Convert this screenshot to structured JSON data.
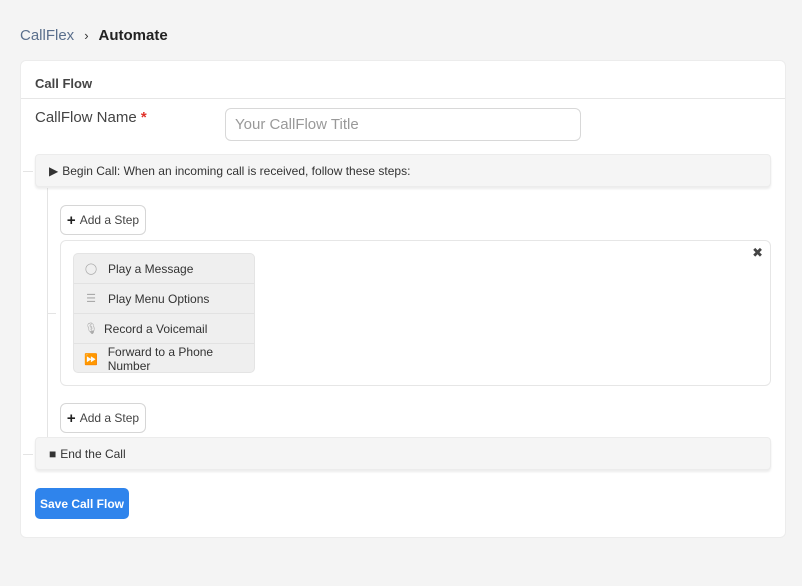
{
  "breadcrumb": {
    "home": "CallFlex",
    "separator": "›",
    "current": "Automate"
  },
  "card": {
    "title": "Call Flow"
  },
  "form": {
    "name_label": "CallFlow Name",
    "required_mark": "*",
    "name_placeholder": "Your CallFlow Title",
    "name_value": ""
  },
  "flow": {
    "begin": {
      "icon": "play-triangle-icon",
      "glyph": "▶",
      "label": "Begin Call: When an incoming call is received, follow these steps:"
    },
    "add_step": {
      "glyph": "+",
      "label": "Add a Step"
    },
    "options_close": "✖",
    "step_options": [
      {
        "icon": "speech-bubble-icon",
        "glyph": "◯",
        "label": "Play a Message"
      },
      {
        "icon": "list-icon",
        "glyph": "☰",
        "label": "Play Menu Options"
      },
      {
        "icon": "microphone-icon",
        "glyph": "🎙",
        "label": "Record a Voicemail"
      },
      {
        "icon": "fast-forward-icon",
        "glyph": "⏩",
        "label": "Forward to a Phone Number"
      }
    ],
    "end": {
      "icon": "stop-square-icon",
      "glyph": "■",
      "label": "End the Call"
    }
  },
  "save_label": "Save Call Flow",
  "colors": {
    "primary": "#2f84ec",
    "required": "#e0322a",
    "link": "#5a6f8c"
  }
}
